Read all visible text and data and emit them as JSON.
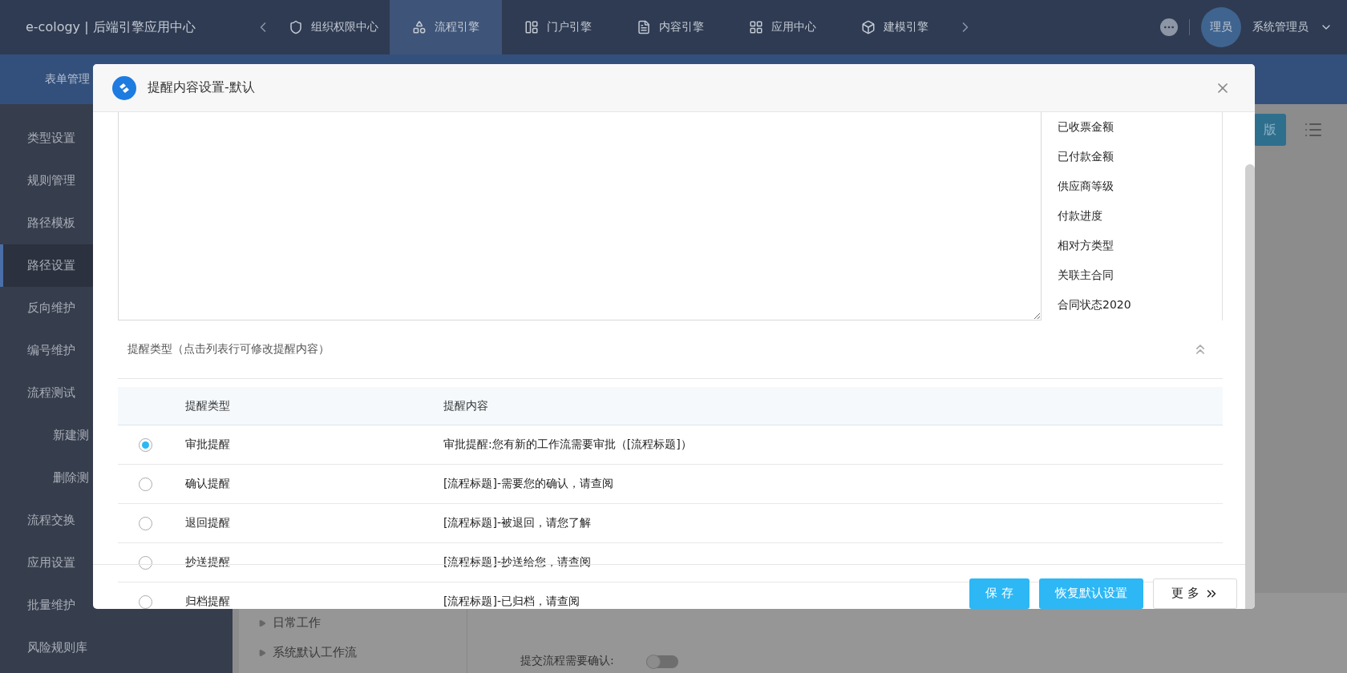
{
  "header": {
    "brand": "e-cology | 后端引擎应用中心",
    "tabs": [
      {
        "label": "组织权限中心",
        "selected": false
      },
      {
        "label": "流程引擎",
        "selected": true
      },
      {
        "label": "门户引擎",
        "selected": false
      },
      {
        "label": "内容引擎",
        "selected": false
      },
      {
        "label": "应用中心",
        "selected": false
      },
      {
        "label": "建模引擎",
        "selected": false
      }
    ],
    "avatar": "理员",
    "user": "系统管理员"
  },
  "subnav": {
    "items": [
      {
        "label": "表单管理"
      }
    ]
  },
  "sidebar": {
    "items": [
      {
        "label": "类型设置",
        "selected": false
      },
      {
        "label": "规则管理",
        "selected": false
      },
      {
        "label": "路径模板",
        "selected": false
      },
      {
        "label": "路径设置",
        "selected": true
      },
      {
        "label": "反向维护",
        "selected": false
      },
      {
        "label": "编号维护",
        "selected": false
      },
      {
        "label": "流程测试",
        "selected": false,
        "children": [
          {
            "label": "新建测",
            "selected": false
          },
          {
            "label": "删除测",
            "selected": false
          }
        ]
      },
      {
        "label": "流程交换",
        "selected": false
      },
      {
        "label": "应用设置",
        "selected": false
      },
      {
        "label": "批量维护",
        "selected": false
      },
      {
        "label": "风险规则库",
        "selected": false
      }
    ]
  },
  "toolbar": {
    "button": "版"
  },
  "tree": [
    {
      "label": "日常工作"
    },
    {
      "label": "系统默认工作流"
    }
  ],
  "form": {
    "label": "提交流程需要确认:",
    "on": false
  },
  "dialog": {
    "title": "提醒内容设置-默认",
    "fields": [
      "已收票金额",
      "已付款金额",
      "供应商等级",
      "付款进度",
      "相对方类型",
      "关联主合同",
      "合同状态2020"
    ],
    "section": "提醒类型（点击列表行可修改提醒内容）",
    "columns": [
      "提醒类型",
      "提醒内容"
    ],
    "rows": [
      {
        "type": "审批提醒",
        "content": "审批提醒:您有新的工作流需要审批（[流程标题]）",
        "selected": true
      },
      {
        "type": "确认提醒",
        "content": "[流程标题]-需要您的确认，请查阅",
        "selected": false
      },
      {
        "type": "退回提醒",
        "content": "[流程标题]-被退回，请您了解",
        "selected": false
      },
      {
        "type": "抄送提醒",
        "content": "[流程标题]-抄送给您，请查阅",
        "selected": false
      },
      {
        "type": "归档提醒",
        "content": "[流程标题]-已归档，请查阅",
        "selected": false
      }
    ],
    "buttons": [
      {
        "label": "保 存",
        "kind": "primary"
      },
      {
        "label": "恢复默认设置",
        "kind": "primary"
      },
      {
        "label": "更 多",
        "kind": "more"
      }
    ]
  }
}
